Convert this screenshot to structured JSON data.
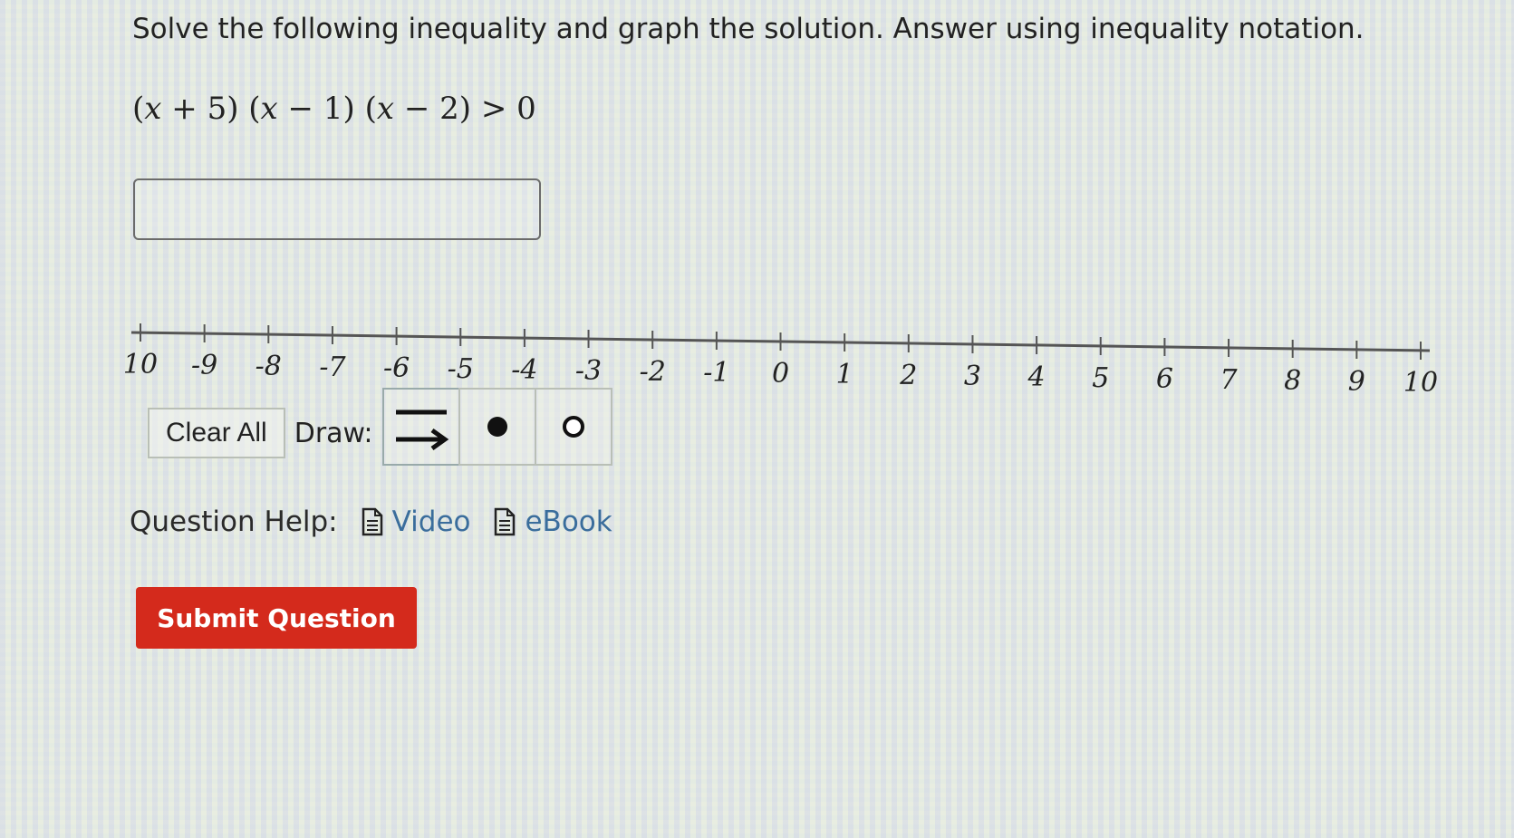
{
  "question": {
    "prompt": "Solve the following inequality and graph the solution. Answer using inequality notation.",
    "equation": {
      "factors": [
        {
          "open": "(",
          "var": "x",
          "op": " + ",
          "num": "5",
          "close": ")"
        },
        {
          "open": "(",
          "var": "x",
          "op": " − ",
          "num": "1",
          "close": ")"
        },
        {
          "open": "(",
          "var": "x",
          "op": " − ",
          "num": "2",
          "close": ")"
        }
      ],
      "relation": " > ",
      "rhs": "0"
    }
  },
  "answer_input": {
    "value": "",
    "placeholder": ""
  },
  "number_line": {
    "min": -10,
    "max": 10,
    "step": 1,
    "tick_labels": [
      "10",
      "-9",
      "-8",
      "-7",
      "-6",
      "-5",
      "-4",
      "-3",
      "-2",
      "-1",
      "0",
      "1",
      "2",
      "3",
      "4",
      "5",
      "6",
      "7",
      "8",
      "9",
      "10"
    ]
  },
  "toolbar": {
    "clear_label": "Clear All",
    "draw_label": "Draw:",
    "tools": [
      {
        "name": "ray-line-tool",
        "icon": "line-and-arrow-icon"
      },
      {
        "name": "closed-dot-tool",
        "icon": "filled-dot-icon"
      },
      {
        "name": "open-dot-tool",
        "icon": "open-dot-icon"
      }
    ]
  },
  "help": {
    "label": "Question Help:",
    "links": [
      {
        "label": "Video",
        "icon": "document-icon"
      },
      {
        "label": "eBook",
        "icon": "document-icon"
      }
    ],
    "link_color": "#3a6d9c"
  },
  "submit": {
    "label": "Submit Question",
    "color": "#d42a1c"
  }
}
